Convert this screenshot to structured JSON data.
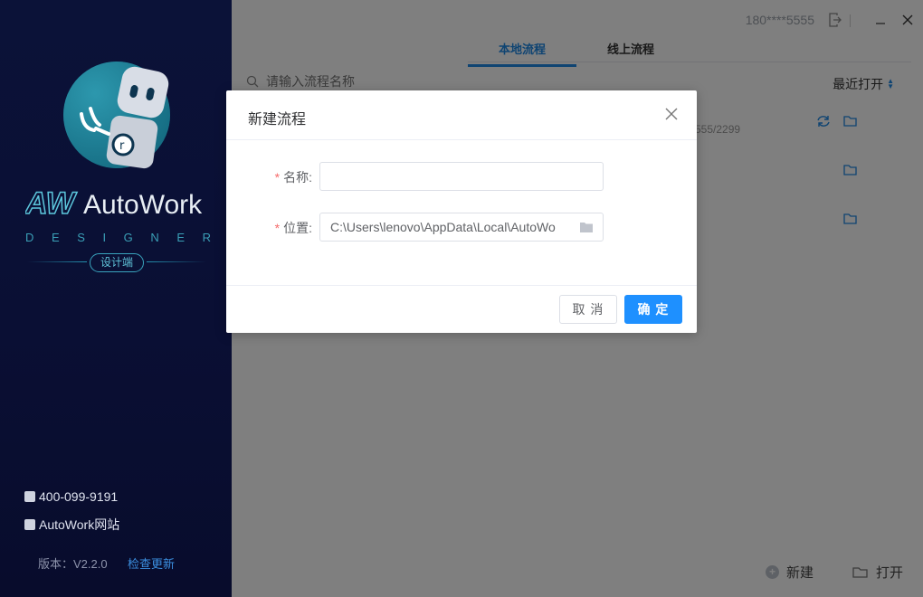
{
  "sidebar": {
    "brand_name": "AutoWork",
    "brand_mark": "AW",
    "designer_letters": [
      "D",
      "E",
      "S",
      "I",
      "G",
      "N",
      "E",
      "R"
    ],
    "designer_tag": "设计端",
    "phone": "400-099-9191",
    "website": "AutoWork网站",
    "version_label": "版本：V2.2.0",
    "check_update": "检查更新"
  },
  "header": {
    "user_phone": "180****5555",
    "logout_icon": "logout-icon",
    "minimize_icon": "minimize-icon",
    "close_icon": "close-icon"
  },
  "tabs": [
    {
      "label": "本地流程",
      "active": true
    },
    {
      "label": "线上流程",
      "active": false
    }
  ],
  "search": {
    "placeholder": "请输入流程名称"
  },
  "sort": {
    "label": "最近打开"
  },
  "list": {
    "first_row_path_fragment": "555/2299"
  },
  "footer": {
    "new_label": "新建",
    "open_label": "打开"
  },
  "dialog": {
    "title": "新建流程",
    "name_label": "名称:",
    "name_value": "",
    "location_label": "位置:",
    "location_value": "C:\\Users\\lenovo\\AppData\\Local\\AutoWo",
    "cancel_label": "取 消",
    "ok_label": "确 定"
  },
  "colors": {
    "accent": "#1e90ff",
    "sidebar_bg": "#0a0f34",
    "required": "#f56c6c"
  }
}
